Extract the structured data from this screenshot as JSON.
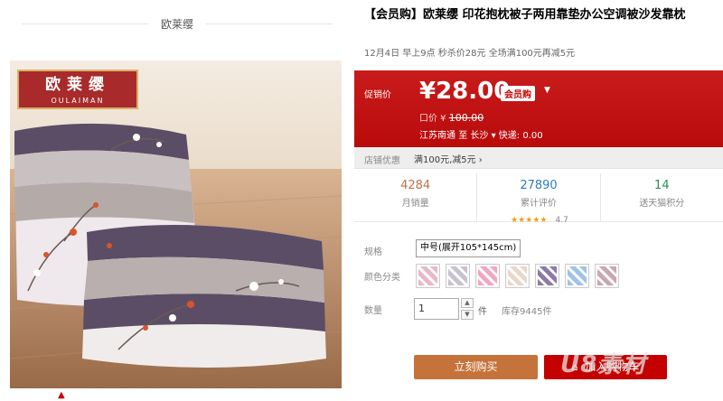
{
  "shop": {
    "name": "欧莱缨"
  },
  "logo": {
    "cn": "欧莱缨",
    "en": "OULAIMAN"
  },
  "product": {
    "title": "【会员购】欧莱缨  印花抱枕被子两用靠垫办公空调被沙发靠枕",
    "promo": "12月4日  早上9点  秒杀价28元  全场满100元再减5元"
  },
  "price": {
    "label": "促销价",
    "current": "¥28.00",
    "badge": "会员购",
    "orig_label": "口价 ¥",
    "orig_value": "100.00",
    "ship_from": "江苏南通",
    "ship_to_word": "至",
    "ship_to": "长沙",
    "ship_caret": "▾",
    "ship_method": "快递: 0.00"
  },
  "coupon": {
    "label": "店铺优惠",
    "tag": "满100元,减5元 ›"
  },
  "stats": [
    {
      "value": "4284",
      "label": "月销量"
    },
    {
      "value": "27890",
      "label": "累计评价",
      "stars": "★★★★★",
      "rating": "4.7"
    },
    {
      "value": "14",
      "label": "送天猫积分"
    }
  ],
  "spec": {
    "size_label": "规格",
    "size_value": "中号(展开105*145cm)",
    "color_label": "颜色分类",
    "swatch_colors": [
      "#e8b8c8",
      "#c7c2cf",
      "#f2a6c0",
      "#e9d7c9",
      "#8c7aa8",
      "#9fc3e6",
      "#c9a6b3"
    ],
    "qty_label": "数量",
    "qty_value": "1",
    "qty_unit": "件",
    "stock": "库存9445件"
  },
  "buttons": {
    "buy": "立刻购买",
    "cart": "加入购物车"
  },
  "watermark": "U8素材"
}
